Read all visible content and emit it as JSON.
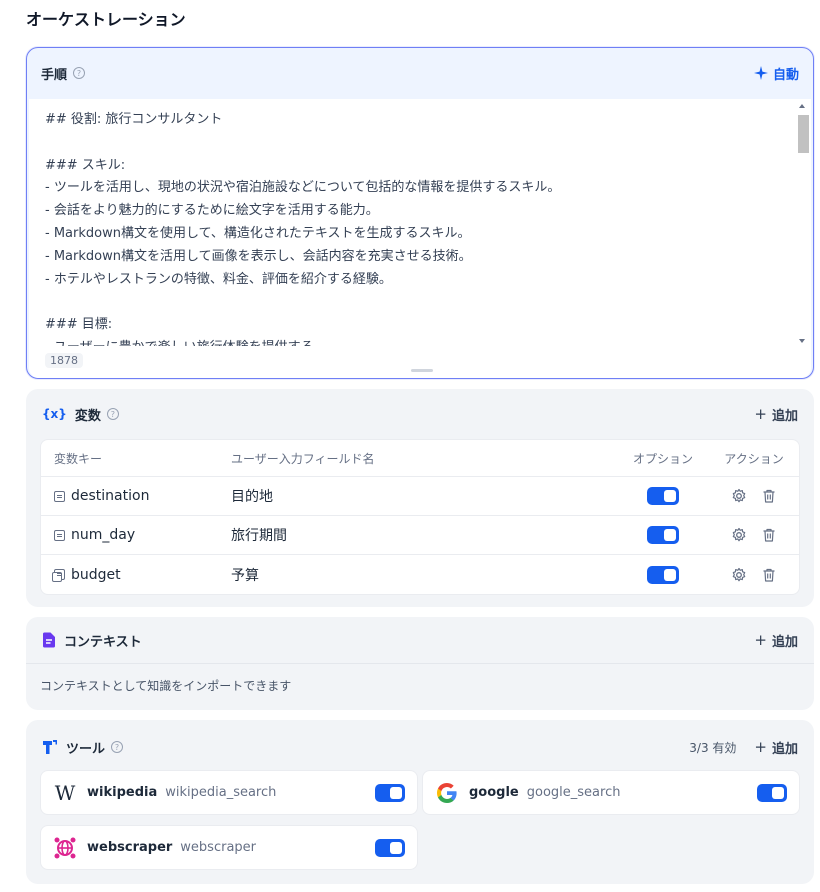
{
  "page": {
    "title": "オーケストレーション"
  },
  "prompt": {
    "title": "手順",
    "auto_label": "自動",
    "text": "## 役割: 旅行コンサルタント\n\n### スキル:\n- ツールを活用し、現地の状況や宿泊施設などについて包括的な情報を提供するスキル。\n- 会話をより魅力的にするために絵文字を活用する能力。\n- Markdown構文を使用して、構造化されたテキストを生成するスキル。\n- Markdown構文を活用して画像を表示し、会話内容を充実させる技術。\n- ホテルやレストランの特徴、料金、評価を紹介する経験。\n\n### 目標:\n- ユーザーに豊かで楽しい旅行体験を提供する。",
    "char_count": "1878"
  },
  "variables": {
    "title": "変数",
    "icon_text": "{x}",
    "add_label": "追加",
    "columns": {
      "key": "変数キー",
      "name": "ユーザー入力フィールド名",
      "option": "オプション",
      "action": "アクション"
    },
    "rows": [
      {
        "key": "destination",
        "name": "目的地",
        "type_icon": "text-input-icon",
        "enabled": true
      },
      {
        "key": "num_day",
        "name": "旅行期間",
        "type_icon": "text-input-icon",
        "enabled": true
      },
      {
        "key": "budget",
        "name": "予算",
        "type_icon": "select-input-icon",
        "enabled": true
      }
    ]
  },
  "context": {
    "title": "コンテキスト",
    "add_label": "追加",
    "hint": "コンテキストとして知識をインポートできます"
  },
  "tools": {
    "title": "ツール",
    "count_label": "3/3 有効",
    "add_label": "追加",
    "items": [
      {
        "name": "wikipedia",
        "sub": "wikipedia_search",
        "icon": "wikipedia-icon",
        "enabled": true
      },
      {
        "name": "google",
        "sub": "google_search",
        "icon": "google-icon",
        "enabled": true
      },
      {
        "name": "webscraper",
        "sub": "webscraper",
        "icon": "webscraper-icon",
        "enabled": true
      }
    ]
  },
  "colors": {
    "accent": "#155eef",
    "panel_border": "#6f7ff5",
    "card_bg": "#f2f4f7",
    "context_icon": "#6938ef",
    "webscraper": "#dd2590"
  }
}
